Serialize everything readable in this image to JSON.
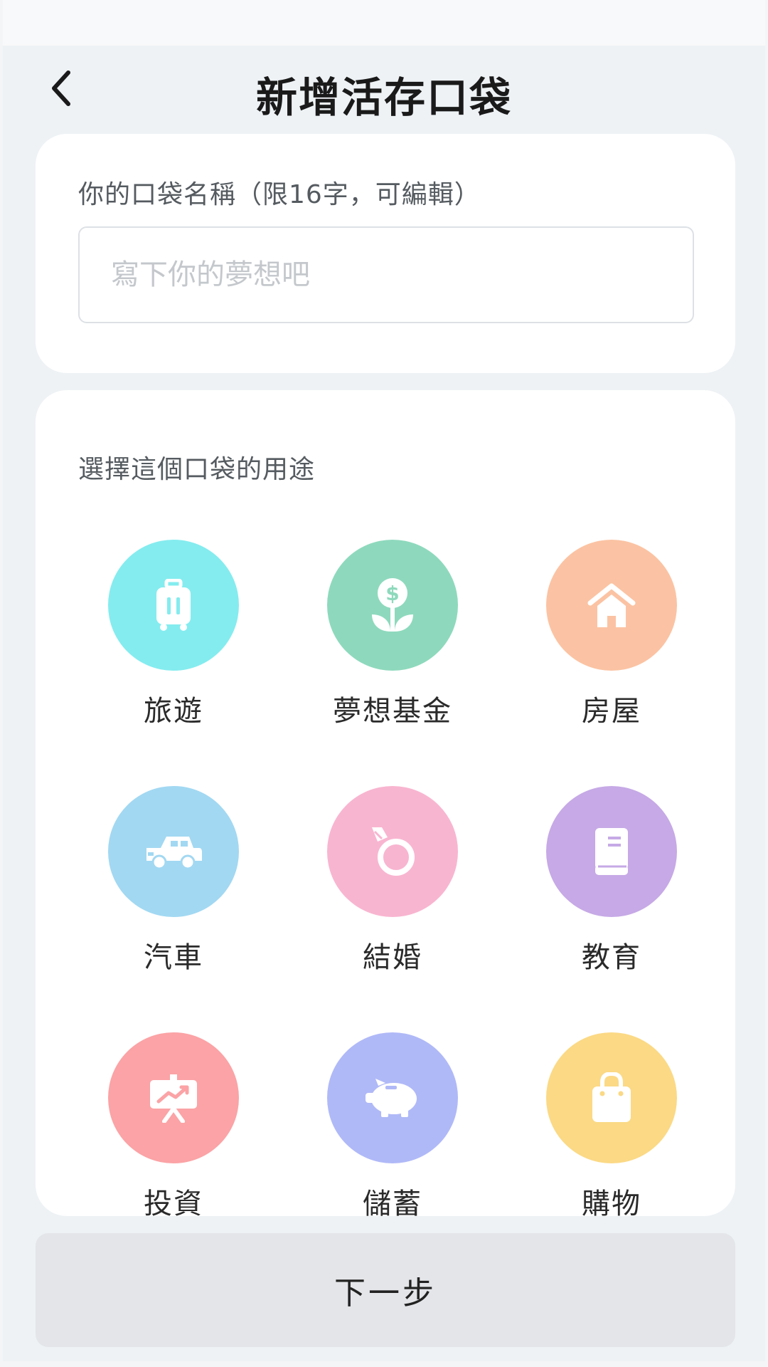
{
  "header": {
    "title": "新增活存口袋"
  },
  "name_section": {
    "label": "你的口袋名稱（限16字，可編輯）",
    "placeholder": "寫下你的夢想吧",
    "value": ""
  },
  "purpose_section": {
    "label": "選擇這個口袋的用途",
    "items": [
      {
        "label": "旅遊",
        "icon": "luggage-icon",
        "color": "#84ecef"
      },
      {
        "label": "夢想基金",
        "icon": "money-plant-icon",
        "color": "#8ed9bd"
      },
      {
        "label": "房屋",
        "icon": "house-icon",
        "color": "#fbc3a3"
      },
      {
        "label": "汽車",
        "icon": "car-icon",
        "color": "#a2d8f2"
      },
      {
        "label": "結婚",
        "icon": "ring-icon",
        "color": "#f8b5d0"
      },
      {
        "label": "教育",
        "icon": "book-icon",
        "color": "#c6a9e6"
      },
      {
        "label": "投資",
        "icon": "investment-chart-icon",
        "color": "#fba3a6"
      },
      {
        "label": "儲蓄",
        "icon": "piggy-bank-icon",
        "color": "#b0b9f7"
      },
      {
        "label": "購物",
        "icon": "shopping-bag-icon",
        "color": "#fbd985"
      }
    ]
  },
  "footer": {
    "next_label": "下一步"
  }
}
